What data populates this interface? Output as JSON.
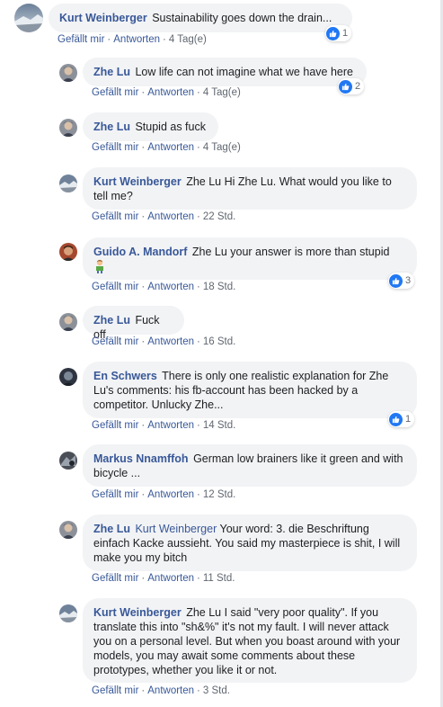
{
  "ui": {
    "like_label": "Gefällt mir",
    "reply_label": "Antworten",
    "separator": "·"
  },
  "icons": {
    "reaction": "thumbs-up-icon",
    "emoji": "person-emoji-icon"
  },
  "colors": {
    "author": "#385898",
    "bubble": "#f2f3f5",
    "like_badge": "#2078f4"
  },
  "comments": [
    {
      "author": "Kurt Weinberger",
      "mention": "",
      "text": "Sustainability goes down the drain...",
      "time": "4 Tag(e)",
      "likes": "1"
    },
    {
      "author": "Zhe Lu",
      "mention": "",
      "text": "Low life can not imagine what we have here",
      "time": "4 Tag(e)",
      "likes": "2"
    },
    {
      "author": "Zhe Lu",
      "mention": "",
      "text": "Stupid as fuck",
      "time": "4 Tag(e)",
      "likes": ""
    },
    {
      "author": "Kurt Weinberger",
      "mention": "",
      "text": "Zhe Lu Hi Zhe Lu. What would you like to tell me?",
      "time": "22 Std.",
      "likes": ""
    },
    {
      "author": "Guido A. Mandorf",
      "mention": "",
      "text": "Zhe Lu your answer is more than stupid",
      "time": "18 Std.",
      "likes": "3"
    },
    {
      "author": "Zhe Lu",
      "mention": "",
      "text": "Fuck off",
      "time": "16 Std.",
      "likes": ""
    },
    {
      "author": "En Schwers",
      "mention": "",
      "text": "There is only one realistic explanation for Zhe Lu's comments: his fb-account has been hacked by a competitor. Unlucky Zhe...",
      "time": "14 Std.",
      "likes": "1"
    },
    {
      "author": "Markus Nnamffoh",
      "mention": "",
      "text": "German low brainers like it green and with bicycle ...",
      "time": "12 Std.",
      "likes": ""
    },
    {
      "author": "Zhe Lu",
      "mention": "Kurt Weinberger",
      "text": "Your word: 3. die Beschriftung einfach Kacke aussieht. You said my masterpiece is shit, I will make you my bitch",
      "time": "11 Std.",
      "likes": ""
    },
    {
      "author": "Kurt Weinberger",
      "mention": "",
      "text": "Zhe Lu I said \"very poor quality\". If you translate this into \"sh&%\" it's not my fault. I will never attack you on a personal level. But when you boast around with your models, you may await some comments about these prototypes, whether you like it or not.",
      "time": "3 Std.",
      "likes": ""
    }
  ]
}
